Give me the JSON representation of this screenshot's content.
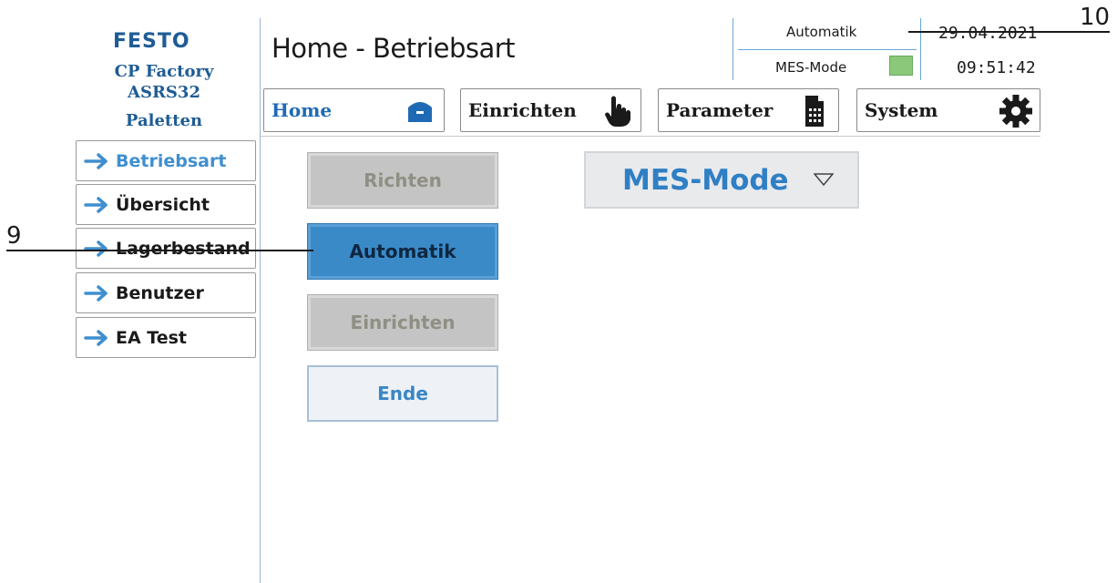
{
  "brand": {
    "logo_text": "FESTO",
    "color": "#1f5c95"
  },
  "sidebar": {
    "title_line1": "CP Factory",
    "title_line2": "ASRS32",
    "title_line3": "Paletten",
    "items": [
      {
        "label": "Betriebsart",
        "icon": "arrow-right-icon",
        "active": true
      },
      {
        "label": "Übersicht",
        "icon": "arrow-right-icon"
      },
      {
        "label": "Lagerbestand",
        "icon": "arrow-right-icon"
      },
      {
        "label": "Benutzer",
        "icon": "arrow-right-icon"
      },
      {
        "label": "EA Test",
        "icon": "arrow-right-icon"
      }
    ]
  },
  "header": {
    "title": "Home - Betriebsart"
  },
  "status": {
    "mode": "Automatik",
    "mes_label": "MES-Mode",
    "mes_indicator_color": "#8cc87a",
    "date": "29.04.2021",
    "time": "09:51:42"
  },
  "tabs": [
    {
      "label": "Home",
      "icon": "home-icon",
      "active": true
    },
    {
      "label": "Einrichten",
      "icon": "hand-pointer-icon"
    },
    {
      "label": "Parameter",
      "icon": "document-calculator-icon"
    },
    {
      "label": "System",
      "icon": "gear-icon"
    }
  ],
  "mode_buttons": [
    {
      "label": "Richten",
      "state": "disabled"
    },
    {
      "label": "Automatik",
      "state": "active"
    },
    {
      "label": "Einrichten",
      "state": "disabled"
    },
    {
      "label": "Ende",
      "state": "normal"
    }
  ],
  "mes_dropdown": {
    "selected": "MES-Mode"
  },
  "callouts": {
    "left": "9",
    "right": "10"
  },
  "colors": {
    "accent": "#3a8ac8",
    "active_text": "#3f8fcf",
    "border": "#9ab4cf"
  }
}
